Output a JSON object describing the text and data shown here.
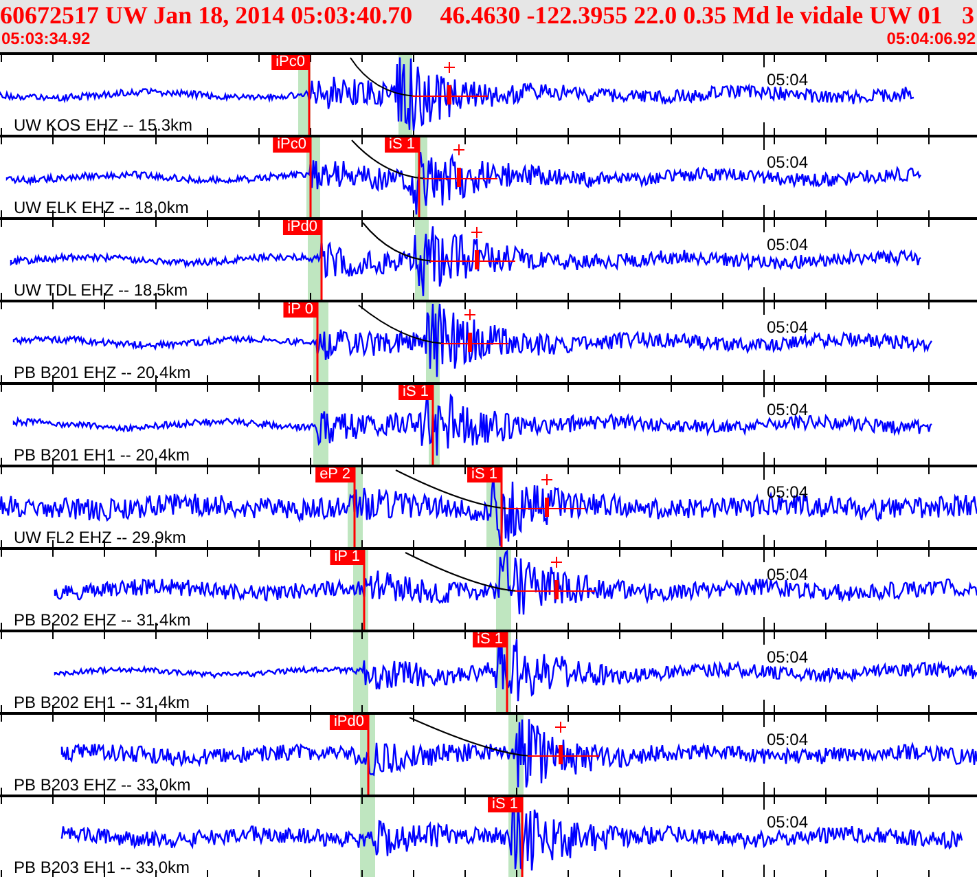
{
  "header": {
    "title": "60672517 UW Jan 18, 2014 05:03:40.70",
    "event": "46.4630 -122.3955 22.0 0.35 Md le vidale UW 01",
    "count": "3",
    "start_time": "05:03:34.92",
    "end_time": "05:04:06.92"
  },
  "traces": [
    {
      "station": "UW KOS EHZ -- 15.3km",
      "minute_label": "05:04",
      "picks": [
        {
          "kind": "p",
          "label": "iPc0"
        }
      ]
    },
    {
      "station": "UW ELK EHZ -- 18.0km",
      "minute_label": "05:04",
      "picks": [
        {
          "kind": "p",
          "label": "iPc0"
        },
        {
          "kind": "s",
          "label": "iS 1"
        }
      ]
    },
    {
      "station": "UW TDL EHZ -- 18.5km",
      "minute_label": "05:04",
      "picks": [
        {
          "kind": "p",
          "label": "iPd0"
        }
      ]
    },
    {
      "station": "PB B201 EHZ -- 20.4km",
      "minute_label": "05:04",
      "picks": [
        {
          "kind": "p",
          "label": "iP 0"
        }
      ]
    },
    {
      "station": "PB B201 EH1 -- 20.4km",
      "minute_label": "05:04",
      "picks": [
        {
          "kind": "s",
          "label": "iS 1"
        }
      ]
    },
    {
      "station": "UW FL2 EHZ -- 29.9km",
      "minute_label": "05:04",
      "picks": [
        {
          "kind": "p",
          "label": "eP 2"
        },
        {
          "kind": "s",
          "label": "iS 1"
        }
      ]
    },
    {
      "station": "PB B202 EHZ -- 31.4km",
      "minute_label": "05:04",
      "picks": [
        {
          "kind": "p",
          "label": "iP 1"
        }
      ]
    },
    {
      "station": "PB B202 EH1 -- 31.4km",
      "minute_label": "05:04",
      "picks": [
        {
          "kind": "s",
          "label": "iS 1"
        }
      ]
    },
    {
      "station": "PB B203 EHZ -- 33.0km",
      "minute_label": "05:04",
      "picks": [
        {
          "kind": "p",
          "label": "iPd0"
        }
      ]
    },
    {
      "station": "PB B203 EH1 -- 33.0km",
      "minute_label": "05:04",
      "picks": [
        {
          "kind": "s",
          "label": "iS 1"
        }
      ]
    }
  ]
}
